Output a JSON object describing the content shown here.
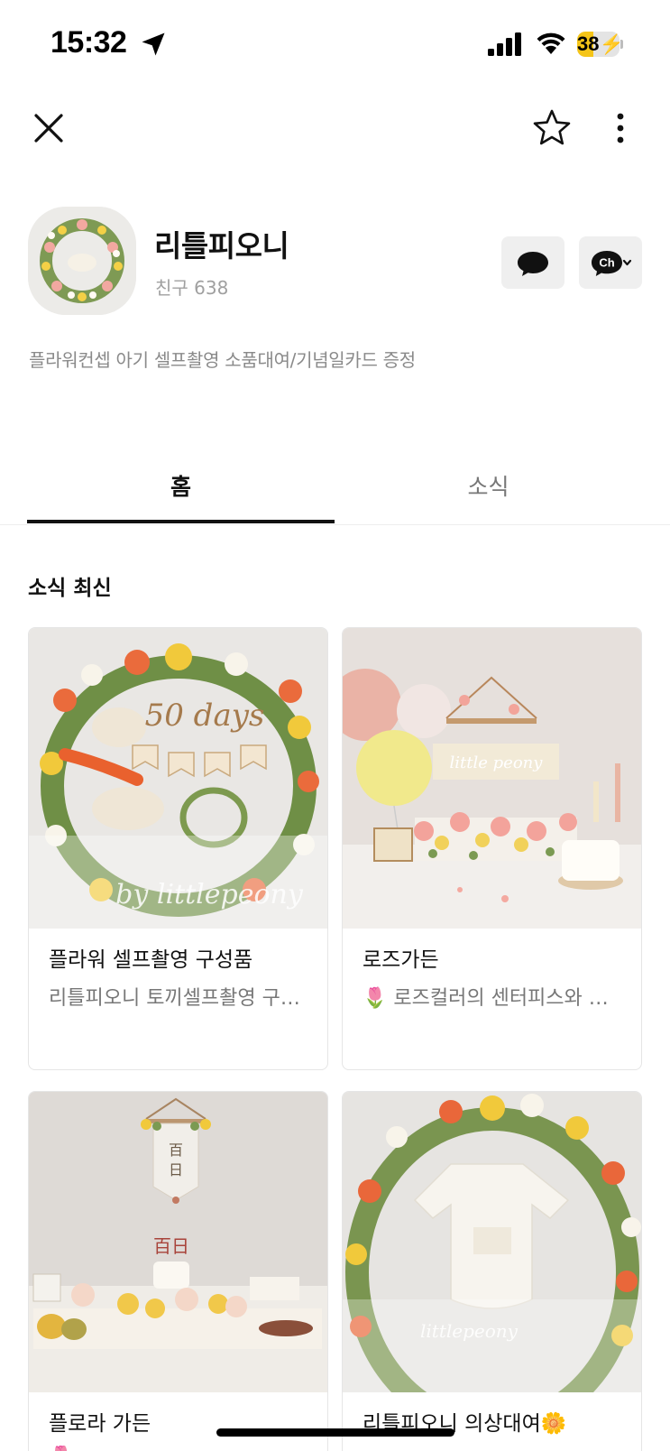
{
  "status_bar": {
    "time": "15:32",
    "battery": "38",
    "battery_level": 0.38,
    "icons": [
      "location-arrow-icon",
      "cellular-signal-icon",
      "wifi-icon",
      "battery-charging-icon"
    ]
  },
  "nav": {
    "icons": [
      "close-icon",
      "star-icon",
      "more-vertical-icon"
    ]
  },
  "profile": {
    "name": "리틀피오니",
    "friends_label": "친구",
    "friends_count": "638",
    "description": "플라워컨셉 아기 셀프촬영 소품대여/기념일카드 증정",
    "chat_icon": "chat-bubble-icon",
    "channel_badge": "Ch"
  },
  "tabs": [
    {
      "label": "홈",
      "active": true
    },
    {
      "label": "소식",
      "active": false
    }
  ],
  "section": {
    "title": "소식 최신"
  },
  "posts": [
    {
      "title": "플라워 셀프촬영 구성품",
      "subtitle": "리틀피오니 토끼셀프촬영 구성품"
    },
    {
      "title": "로즈가든",
      "subtitle": "🌷 로즈컬러의 센터피스와 꽃장식"
    },
    {
      "title": "플로라 가든",
      "subtitle": "🌷"
    },
    {
      "title": "리틀피오니 의상대여🌼",
      "subtitle": ""
    }
  ],
  "theme": {
    "accent": "#111111",
    "muted_text": "#8a8a8a",
    "button_bg": "#efefef",
    "battery_fill": "#f5c518"
  }
}
